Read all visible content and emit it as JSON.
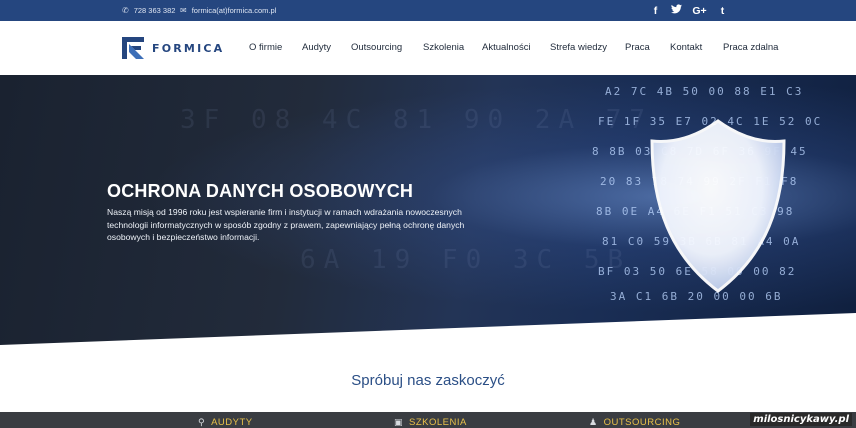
{
  "topbar": {
    "phone_icon": "phone-icon",
    "phone": "728 363 382",
    "mail_icon": "envelope-icon",
    "email": "formica(at)formica.com.pl",
    "social": [
      {
        "name": "facebook-icon",
        "glyph": "f"
      },
      {
        "name": "twitter-icon",
        "glyph": "t"
      },
      {
        "name": "google-plus-icon",
        "glyph": "G+"
      },
      {
        "name": "tumblr-icon",
        "glyph": "t"
      }
    ]
  },
  "header": {
    "brand": "FORMICA",
    "nav": [
      "O firmie",
      "Audyty",
      "Outsourcing",
      "Szkolenia",
      "Aktualności",
      "Strefa wiedzy",
      "Praca",
      "Kontakt",
      "Praca zdalna"
    ]
  },
  "hero": {
    "title": "OCHRONA DANYCH OSOBOWYCH",
    "text": "Naszą misją od 1996 roku jest wspieranie firm i instytucji w ramach wdrażania nowoczesnych technologii informatycznych w sposób zgodny z prawem, zapewniający pełną ochronę danych osobowych i bezpieczeństwo informacji.",
    "image": "data-security-shield"
  },
  "slogan": "Spróbuj nas zaskoczyć",
  "strip": {
    "items": [
      {
        "icon": "search-icon",
        "label": "AUDYTY"
      },
      {
        "icon": "presentation-icon",
        "label": "SZKOLENIA"
      },
      {
        "icon": "users-icon",
        "label": "OUTSOURCING"
      }
    ]
  },
  "watermark": "milosnicykawy.pl",
  "colors": {
    "brand_blue": "#25467f",
    "slogan_blue": "#2b4f86",
    "strip_bg": "#3a3d42",
    "strip_label": "#e8c04a"
  }
}
